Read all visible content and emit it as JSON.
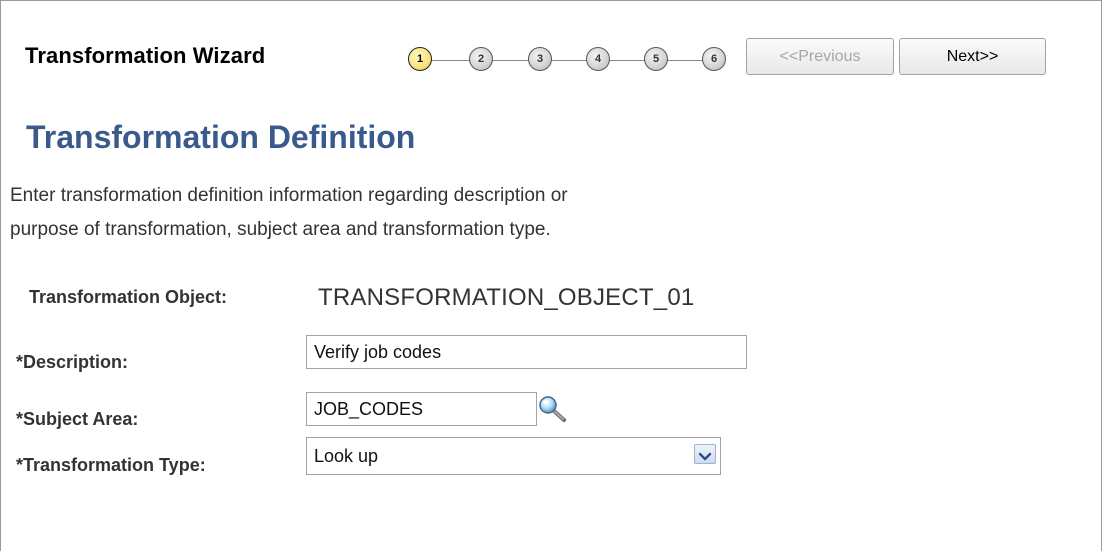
{
  "wizard": {
    "title": "Transformation Wizard",
    "steps": [
      "1",
      "2",
      "3",
      "4",
      "5",
      "6"
    ],
    "active_step": 1,
    "previous_label": "<<Previous",
    "next_label": "Next>>"
  },
  "page": {
    "title": "Transformation Definition",
    "instructions_line1": "Enter transformation definition information regarding description or",
    "instructions_line2": "purpose of transformation, subject area and transformation type."
  },
  "form": {
    "object_label": "Transformation Object:",
    "object_value": "TRANSFORMATION_OBJECT_01",
    "description_label": "*Description:",
    "description_value": "Verify job codes",
    "subject_area_label": "*Subject Area:",
    "subject_area_value": "JOB_CODES",
    "type_label": "*Transformation Type:",
    "type_value": "Look up"
  },
  "icons": {
    "lookup": "magnifier-icon",
    "dropdown": "chevron-down-icon"
  },
  "colors": {
    "title_blue": "#3a5a8c",
    "active_step": "#f8e27a"
  }
}
